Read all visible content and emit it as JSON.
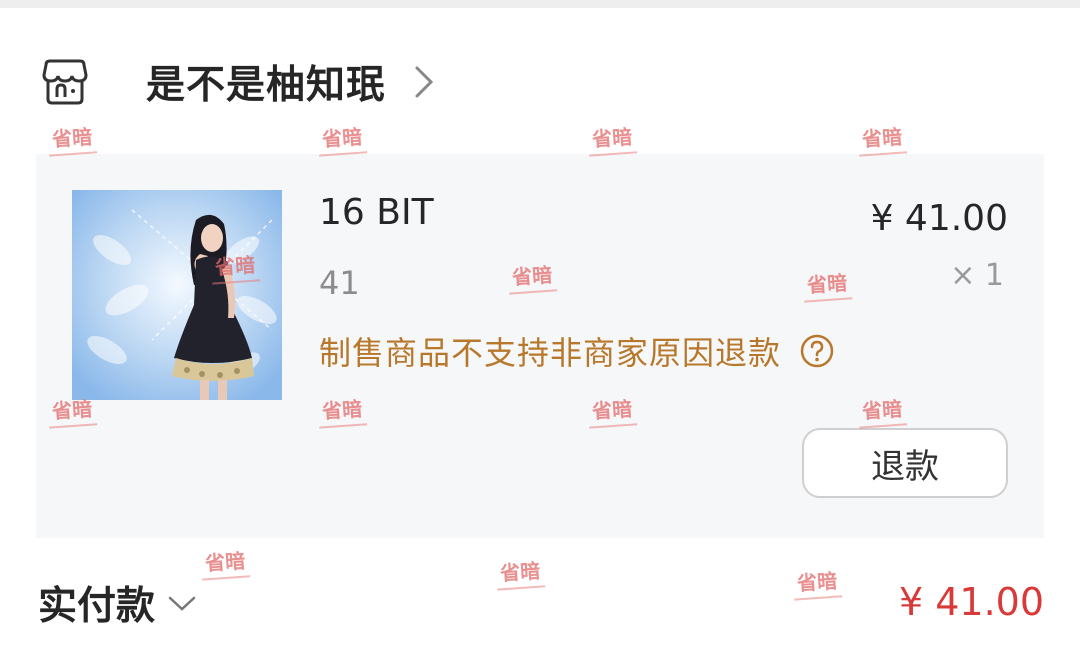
{
  "shop": {
    "name": "是不是柚知珉",
    "icon": "store-icon",
    "arrow_icon": "chevron-right-icon"
  },
  "item": {
    "image_icon": "product-photo",
    "title": "16 BIT",
    "price": "¥ 41.00",
    "variant": "41",
    "quantity": "× 1",
    "notice": "制售商品不支持非商家原因退款",
    "help_icon": "question-circle-icon",
    "refund_label": "退款"
  },
  "payment": {
    "label": "实付款",
    "chevron_icon": "chevron-down-icon",
    "amount": "¥ 41.00"
  },
  "watermark": {
    "text": "省暗",
    "color": "#e26b6b"
  },
  "colors": {
    "notice": "#b8782b",
    "amount": "#d83a3a",
    "card_bg": "#f6f7f9"
  }
}
